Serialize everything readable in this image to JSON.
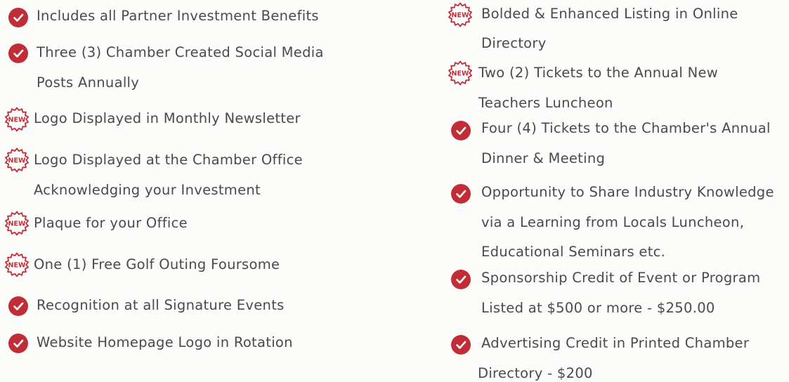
{
  "icons": {
    "check": "check-circle-icon",
    "new": "new-starburst-icon",
    "new_badge_text": "NEW",
    "accent_color": "#c12d37"
  },
  "left_column": [
    {
      "icon": "check",
      "lines": [
        "Includes all Partner Investment Benefits"
      ]
    },
    {
      "icon": "check",
      "lines": [
        "Three (3) Chamber Created Social Media",
        "Posts Annually"
      ]
    },
    {
      "icon": "new",
      "lines": [
        "Logo Displayed in Monthly Newsletter"
      ]
    },
    {
      "icon": "new",
      "lines": [
        "Logo Displayed at the Chamber Office",
        "Acknowledging your Investment"
      ]
    },
    {
      "icon": "new",
      "lines": [
        "Plaque for your Office"
      ]
    },
    {
      "icon": "new",
      "lines": [
        "One (1) Free Golf Outing Foursome"
      ]
    },
    {
      "icon": "check",
      "lines": [
        "Recognition at all Signature Events"
      ]
    },
    {
      "icon": "check",
      "lines": [
        "Website Homepage Logo in Rotation"
      ]
    }
  ],
  "right_column": [
    {
      "icon": "new",
      "lines": [
        "Bolded & Enhanced Listing in Online",
        "Directory"
      ]
    },
    {
      "icon": "new",
      "lines": [
        "Two (2) Tickets to the Annual New",
        "Teachers Luncheon"
      ]
    },
    {
      "icon": "check",
      "lines": [
        "Four (4) Tickets to the Chamber's Annual",
        "Dinner & Meeting"
      ]
    },
    {
      "icon": "check",
      "lines": [
        "Opportunity to Share Industry Knowledge",
        "via a Learning from Locals Luncheon,",
        "Educational Seminars etc."
      ]
    },
    {
      "icon": "check",
      "lines": [
        "Sponsorship Credit of Event or Program",
        "Listed at $500 or more - $250.00"
      ]
    },
    {
      "icon": "check",
      "lines": [
        "Advertising Credit in Printed Chamber",
        "Directory - $200"
      ]
    }
  ]
}
